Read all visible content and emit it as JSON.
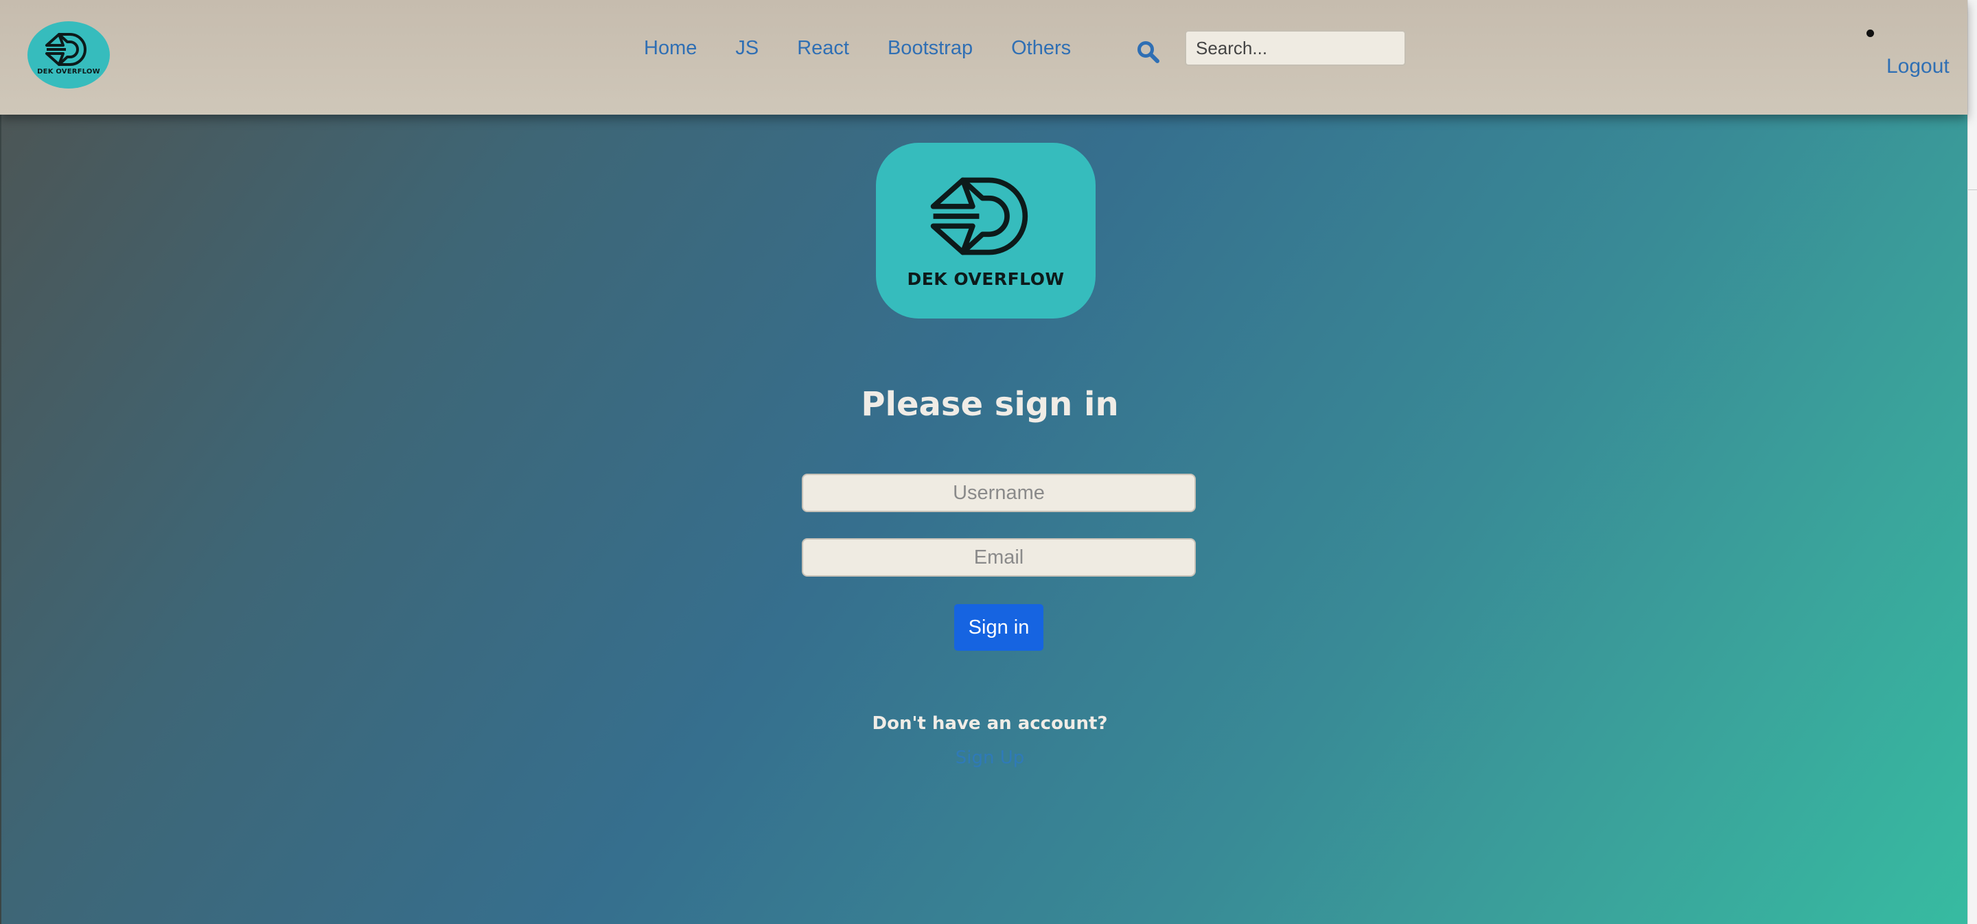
{
  "navbar": {
    "logo_text": "DEK OVERFLOW",
    "links": [
      {
        "label": "Home"
      },
      {
        "label": "JS"
      },
      {
        "label": "React"
      },
      {
        "label": "Bootstrap"
      },
      {
        "label": "Others"
      }
    ],
    "search_icon": "search-icon",
    "search_placeholder": "Search...",
    "logout_label": "Logout"
  },
  "hero": {
    "logo_text": "DEK OVERFLOW"
  },
  "signin": {
    "title": "Please sign in",
    "username_placeholder": "Username",
    "email_placeholder": "Email",
    "button_label": "Sign in",
    "no_account_text": "Don't have an account?",
    "signup_label": "Sign Up"
  },
  "colors": {
    "accent_teal": "#36bcbd",
    "link_blue": "#2f6fb4",
    "button_blue": "#1664e1",
    "navbar_bg": "#c9c0b2"
  }
}
